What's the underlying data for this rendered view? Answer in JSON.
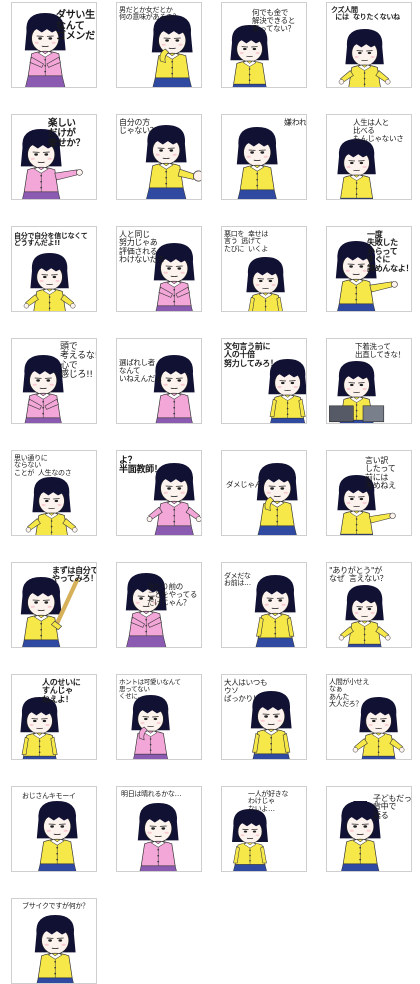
{
  "sheet": {
    "stickers": [
      {
        "caption": "ダサい生き方\nなんて\nゴメンだ!!",
        "style": "bold",
        "skirt": "#8a5bb0"
      },
      {
        "caption": "男だとか女だとか\n何の意味があるの？",
        "style": "vert",
        "skirt": "#2f4aa0"
      },
      {
        "caption": "何でも金で\n解決できると\n思ってない？",
        "style": "plain",
        "skirt": "#2f4aa0"
      },
      {
        "caption": "クズ人間\n  には  なりたくないね",
        "style": "bold",
        "skirt": "#2f4aa0"
      },
      {
        "caption": "楽しい\nだけが\n幸せか？",
        "style": "bold",
        "skirt": "#8a5bb0"
      },
      {
        "caption": "自分の方\nじゃない？",
        "style": "vert",
        "skirt": "#2f4aa0"
      },
      {
        "caption": "嫌われてるのは",
        "style": "vert",
        "skirt": "#2f4aa0"
      },
      {
        "caption": "人生は人と\n比べる\nもんじゃないさ",
        "style": "plain",
        "skirt": "#2f4aa0"
      },
      {
        "caption": "自分で自分を信じなくて\nどうすんだよ!!",
        "style": "bold",
        "skirt": "#2f4aa0"
      },
      {
        "caption": "人と同じ\n努力じゃあ\n評価される\nわけないだろ",
        "style": "vert",
        "skirt": "#8a5bb0"
      },
      {
        "caption": "悪口を  幸せは\n言う  逃げて\nたびに  いくよ",
        "style": "plain",
        "skirt": "#2f4aa0"
      },
      {
        "caption": "一度\n失敗した\nからって\nすぐに\n諦めんなよ！",
        "style": "bold",
        "skirt": "#2f4aa0"
      },
      {
        "caption": "頭で\n考えるな!!\n心で\n感じろ!!",
        "style": "vert",
        "skirt": "#8a5bb0"
      },
      {
        "caption": "選ばれし者\nなんて\nいねえんだよ",
        "style": "plain",
        "skirt": "#8a5bb0"
      },
      {
        "caption": "文句言う前に\n人の十倍\n努力してみろ！",
        "style": "bold",
        "skirt": "#2f4aa0"
      },
      {
        "caption": "下着洗って\n出直してきな！",
        "style": "plain",
        "skirt": "#2f4aa0"
      },
      {
        "caption": "思い通りに\nならない\nことが  人生なのさ",
        "style": "plain",
        "skirt": "#2f4aa0"
      },
      {
        "caption": "よ？\n半面教師！",
        "style": "bold",
        "skirt": "#8a5bb0"
      },
      {
        "caption": "ダメじゃん",
        "style": "plain",
        "skirt": "#2f4aa0"
      },
      {
        "caption": "言い訳\nしたって\n前には\n進めねえ",
        "style": "plain",
        "skirt": "#2f4aa0"
      },
      {
        "caption": "まずは自分で\nやってみろ！",
        "style": "bold",
        "skirt": "#2f4aa0"
      },
      {
        "caption": "当たり前の\nことをやってる\nだけじゃん？",
        "style": "plain",
        "skirt": "#8a5bb0"
      },
      {
        "caption": "ダメだな\nお前は…",
        "style": "plain",
        "skirt": "#2f4aa0"
      },
      {
        "caption": "\"ありがとう\"が\nなぜ  言えない？",
        "style": "plain",
        "skirt": "#2f4aa0"
      },
      {
        "caption": "人のせいに\nすんじゃ\nねえよ！",
        "style": "bold",
        "skirt": "#2f4aa0"
      },
      {
        "caption": "ホントは可愛いなんて\n思ってない\nくせに…",
        "style": "plain",
        "skirt": "#8a5bb0"
      },
      {
        "caption": "大人はいつも\nウソ\nばっかり！",
        "style": "plain",
        "skirt": "#2f4aa0"
      },
      {
        "caption": "人間が小せえ\nなぁ\nあんた\n大人だろ？",
        "style": "plain",
        "skirt": "#2f4aa0"
      },
      {
        "caption": "おじさんキモーイ",
        "style": "plain",
        "skirt": "#2f4aa0"
      },
      {
        "caption": "明日は晴れるかな…",
        "style": "plain",
        "skirt": "#8a5bb0"
      },
      {
        "caption": "一人が好きな\nわけじゃ\nないよ…",
        "style": "plain",
        "skirt": "#2f4aa0"
      },
      {
        "caption": "子どもだって\n背中で\n語る",
        "style": "plain",
        "skirt": "#2f4aa0"
      },
      {
        "caption": "ブサイクですが何か？",
        "style": "plain",
        "skirt": "#2f4aa0"
      }
    ]
  }
}
